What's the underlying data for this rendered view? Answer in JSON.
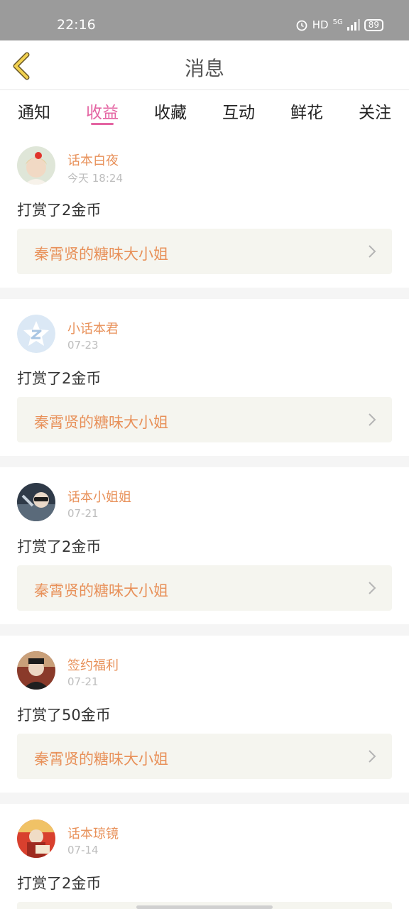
{
  "status_bar": {
    "time": "22:16",
    "hd": "HD",
    "network": "5G",
    "battery": "89"
  },
  "header": {
    "title": "消息"
  },
  "tabs": [
    {
      "label": "通知",
      "active": false
    },
    {
      "label": "收益",
      "active": true
    },
    {
      "label": "收藏",
      "active": false
    },
    {
      "label": "互动",
      "active": false
    },
    {
      "label": "鲜花",
      "active": false
    },
    {
      "label": "关注",
      "active": false
    }
  ],
  "messages": [
    {
      "user": "话本白夜",
      "time": "今天 18:24",
      "text": "打赏了2金币",
      "work": "秦霄贤的糖味大小姐"
    },
    {
      "user": "小话本君",
      "time": "07-23",
      "text": "打赏了2金币",
      "work": "秦霄贤的糖味大小姐"
    },
    {
      "user": "话本小姐姐",
      "time": "07-21",
      "text": "打赏了2金币",
      "work": "秦霄贤的糖味大小姐"
    },
    {
      "user": "签约福利",
      "time": "07-21",
      "text": "打赏了50金币",
      "work": "秦霄贤的糖味大小姐"
    },
    {
      "user": "话本琼镜",
      "time": "07-14",
      "text": "打赏了2金币",
      "work": ""
    }
  ],
  "colors": {
    "accent": "#e464a2",
    "name": "#e8915a",
    "status_bar": "#9b9b9b"
  }
}
